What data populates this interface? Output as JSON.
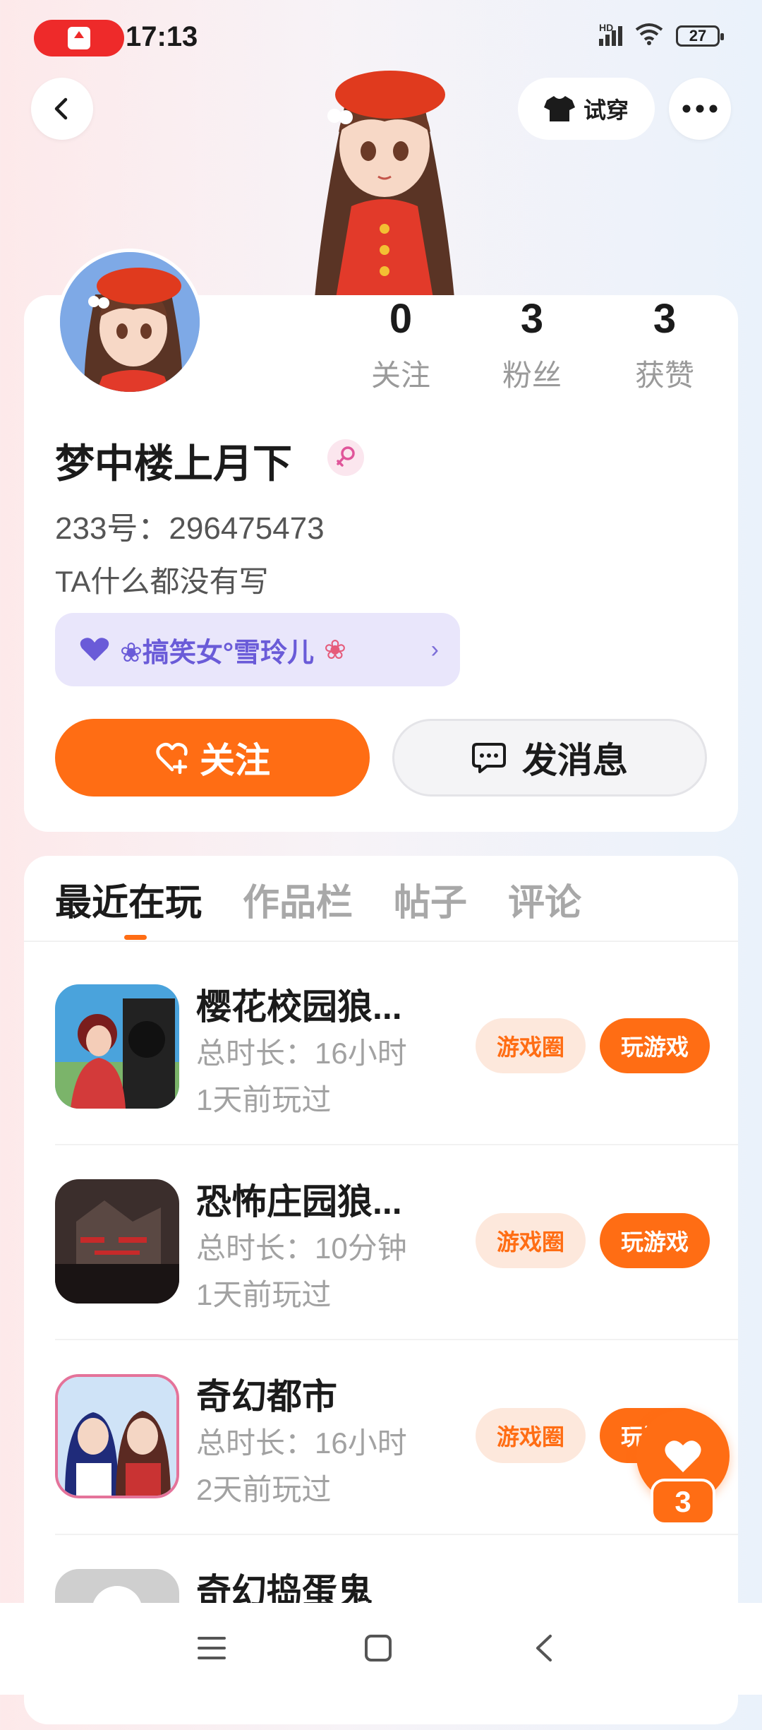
{
  "status_bar": {
    "time": "17:13",
    "hd": "HD",
    "battery": "27"
  },
  "header": {
    "try_on_label": "试穿"
  },
  "profile": {
    "stats": [
      {
        "value": "0",
        "label": "关注"
      },
      {
        "value": "3",
        "label": "粉丝"
      },
      {
        "value": "3",
        "label": "获赞"
      }
    ],
    "username": "梦中楼上月下",
    "uid": "233号：296475473",
    "bio": "TA什么都没有写",
    "club": "❀搞笑女°雪玲儿",
    "follow_label": "关注",
    "message_label": "发消息"
  },
  "tabs": [
    "最近在玩",
    "作品栏",
    "帖子",
    "评论"
  ],
  "games": [
    {
      "title": "樱花校园狼...",
      "duration": "总时长：16小时",
      "last_played": "1天前玩过",
      "circle_label": "游戏圈",
      "play_label": "玩游戏"
    },
    {
      "title": "恐怖庄园狼...",
      "duration": "总时长：10分钟",
      "last_played": "1天前玩过",
      "circle_label": "游戏圈",
      "play_label": "玩游戏"
    },
    {
      "title": "奇幻都市",
      "duration": "总时长：16小时",
      "last_played": "2天前玩过",
      "circle_label": "游戏圈",
      "play_label": "玩游戏"
    },
    {
      "title": "奇幻捣蛋鬼"
    }
  ],
  "floating_like": {
    "count": "3"
  },
  "colors": {
    "accent": "#ff6d14",
    "club_bg": "#e9e6fb",
    "club_text": "#6a5bd8"
  },
  "icons": [
    "back-icon",
    "shirt-icon",
    "more-icon",
    "female-icon",
    "heart-icon",
    "follow-heart-icon",
    "chat-icon",
    "menu-icon",
    "home-square-icon",
    "nav-back-icon"
  ]
}
